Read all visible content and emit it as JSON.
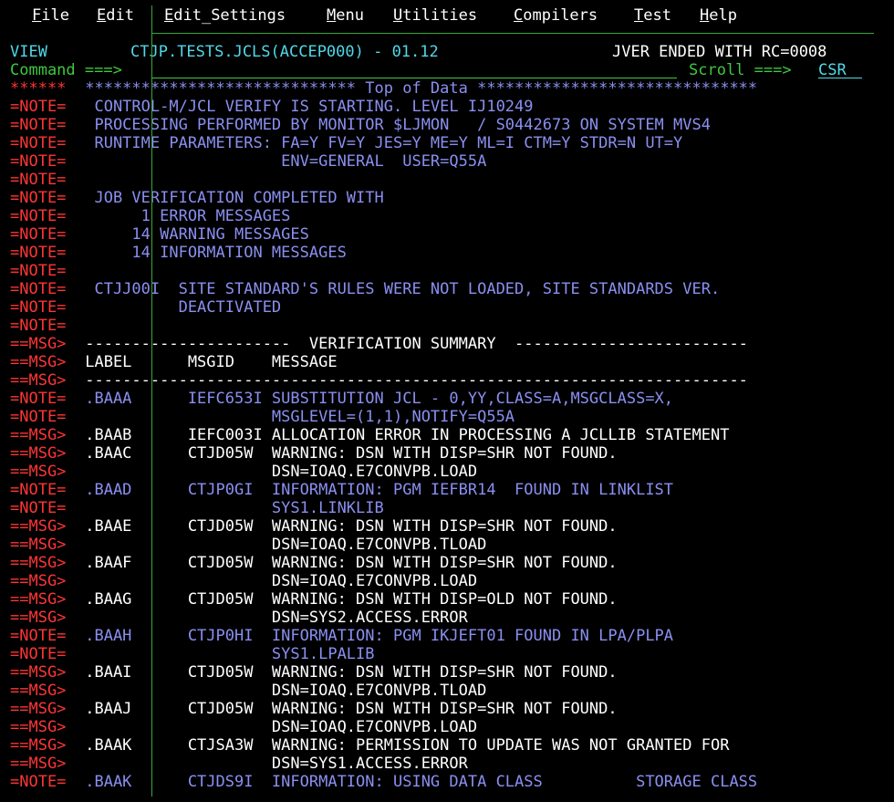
{
  "menu": {
    "items": [
      {
        "key": "file",
        "ul": "F",
        "rest": "ile"
      },
      {
        "key": "edit",
        "ul": "E",
        "rest": "dit"
      },
      {
        "key": "edit_settings",
        "ul": "E",
        "rest": "dit_Settings"
      },
      {
        "key": "menu",
        "ul": "M",
        "rest": "enu"
      },
      {
        "key": "utilities",
        "ul": "U",
        "rest": "tilities"
      },
      {
        "key": "compilers",
        "ul": "C",
        "rest": "ompilers"
      },
      {
        "key": "test",
        "ul": "T",
        "rest": "est"
      },
      {
        "key": "help",
        "ul": "H",
        "rest": "elp"
      }
    ]
  },
  "header": {
    "mode": "VIEW",
    "dataset": "CTJP.TESTS.JCLS(ACCEP000) - 01.12",
    "status": "JVER ENDED WITH RC=0008",
    "command_label": "Command ===>",
    "command_value": "",
    "scroll_label": "Scroll ===>",
    "scroll_value": "CSR"
  },
  "lines": [
    {
      "prefix": "******",
      "type": "top",
      "text": " ***************************** Top of Data ******************************"
    },
    {
      "prefix": "=NOTE=",
      "type": "note",
      "text": "  CONTROL-M/JCL VERIFY IS STARTING. LEVEL IJ10249"
    },
    {
      "prefix": "=NOTE=",
      "type": "note",
      "text": "  PROCESSING PERFORMED BY MONITOR $LJMON   / S0442673 ON SYSTEM MVS4"
    },
    {
      "prefix": "=NOTE=",
      "type": "note",
      "text": "  RUNTIME PARAMETERS: FA=Y FV=Y JES=Y ME=Y ML=I CTM=Y STDR=N UT=Y"
    },
    {
      "prefix": "=NOTE=",
      "type": "note",
      "text": "                      ENV=GENERAL  USER=Q55A"
    },
    {
      "prefix": "=NOTE=",
      "type": "note",
      "text": ""
    },
    {
      "prefix": "=NOTE=",
      "type": "note",
      "text": "  JOB VERIFICATION COMPLETED WITH"
    },
    {
      "prefix": "=NOTE=",
      "type": "note",
      "text": "       1 ERROR MESSAGES"
    },
    {
      "prefix": "=NOTE=",
      "type": "note",
      "text": "      14 WARNING MESSAGES"
    },
    {
      "prefix": "=NOTE=",
      "type": "note",
      "text": "      14 INFORMATION MESSAGES"
    },
    {
      "prefix": "=NOTE=",
      "type": "note",
      "text": ""
    },
    {
      "prefix": "=NOTE=",
      "type": "note",
      "text": "  CTJJ00I  SITE STANDARD'S RULES WERE NOT LOADED, SITE STANDARDS VER."
    },
    {
      "prefix": "=NOTE=",
      "type": "note",
      "text": "           DEACTIVATED"
    },
    {
      "prefix": "=NOTE=",
      "type": "note",
      "text": ""
    },
    {
      "prefix": "==MSG>",
      "type": "msg",
      "text": " ----------------------  VERIFICATION SUMMARY  -------------------------"
    },
    {
      "prefix": "==MSG>",
      "type": "msg",
      "text": " LABEL      MSGID    MESSAGE"
    },
    {
      "prefix": "==MSG>",
      "type": "msg",
      "text": " -----------------------------------------------------------------------"
    },
    {
      "prefix": "=NOTE=",
      "type": "note",
      "text": " .BAAA      IEFC653I SUBSTITUTION JCL - 0,YY,CLASS=A,MSGCLASS=X,"
    },
    {
      "prefix": "=NOTE=",
      "type": "note",
      "text": "                     MSGLEVEL=(1,1),NOTIFY=Q55A"
    },
    {
      "prefix": "==MSG>",
      "type": "msg",
      "text": " .BAAB      IEFC003I ALLOCATION ERROR IN PROCESSING A JCLLIB STATEMENT"
    },
    {
      "prefix": "==MSG>",
      "type": "msg",
      "text": " .BAAC      CTJD05W  WARNING: DSN WITH DISP=SHR NOT FOUND."
    },
    {
      "prefix": "==MSG>",
      "type": "msg",
      "text": "                     DSN=IOAQ.E7CONVPB.LOAD"
    },
    {
      "prefix": "=NOTE=",
      "type": "note",
      "text": " .BAAD      CTJP0GI  INFORMATION: PGM IEFBR14  FOUND IN LINKLIST"
    },
    {
      "prefix": "=NOTE=",
      "type": "note",
      "text": "                     SYS1.LINKLIB"
    },
    {
      "prefix": "==MSG>",
      "type": "msg",
      "text": " .BAAE      CTJD05W  WARNING: DSN WITH DISP=SHR NOT FOUND."
    },
    {
      "prefix": "==MSG>",
      "type": "msg",
      "text": "                     DSN=IOAQ.E7CONVPB.TLOAD"
    },
    {
      "prefix": "==MSG>",
      "type": "msg",
      "text": " .BAAF      CTJD05W  WARNING: DSN WITH DISP=SHR NOT FOUND."
    },
    {
      "prefix": "==MSG>",
      "type": "msg",
      "text": "                     DSN=IOAQ.E7CONVPB.LOAD"
    },
    {
      "prefix": "==MSG>",
      "type": "msg",
      "text": " .BAAG      CTJD05W  WARNING: DSN WITH DISP=OLD NOT FOUND."
    },
    {
      "prefix": "==MSG>",
      "type": "msg",
      "text": "                     DSN=SYS2.ACCESS.ERROR"
    },
    {
      "prefix": "=NOTE=",
      "type": "note",
      "text": " .BAAH      CTJP0HI  INFORMATION: PGM IKJEFT01 FOUND IN LPA/PLPA"
    },
    {
      "prefix": "=NOTE=",
      "type": "note",
      "text": "                     SYS1.LPALIB"
    },
    {
      "prefix": "==MSG>",
      "type": "msg",
      "text": " .BAAI      CTJD05W  WARNING: DSN WITH DISP=SHR NOT FOUND."
    },
    {
      "prefix": "==MSG>",
      "type": "msg",
      "text": "                     DSN=IOAQ.E7CONVPB.TLOAD"
    },
    {
      "prefix": "==MSG>",
      "type": "msg",
      "text": " .BAAJ      CTJD05W  WARNING: DSN WITH DISP=SHR NOT FOUND."
    },
    {
      "prefix": "==MSG>",
      "type": "msg",
      "text": "                     DSN=IOAQ.E7CONVPB.LOAD"
    },
    {
      "prefix": "==MSG>",
      "type": "msg",
      "text": " .BAAK      CTJSA3W  WARNING: PERMISSION TO UPDATE WAS NOT GRANTED FOR"
    },
    {
      "prefix": "==MSG>",
      "type": "msg",
      "text": "                     DSN=SYS1.ACCESS.ERROR"
    },
    {
      "prefix": "=NOTE=",
      "type": "note",
      "text": " .BAAK      CTJDS9I  INFORMATION: USING DATA CLASS          STORAGE CLASS"
    }
  ],
  "colors": {
    "background": "#000000",
    "menu_text": "#ffffff",
    "note_text": "#8a8ff0",
    "msg_text": "#ffffff",
    "prefix": "#ff3535",
    "command": "#3ec83e",
    "scroll_value": "#50d8e8"
  }
}
